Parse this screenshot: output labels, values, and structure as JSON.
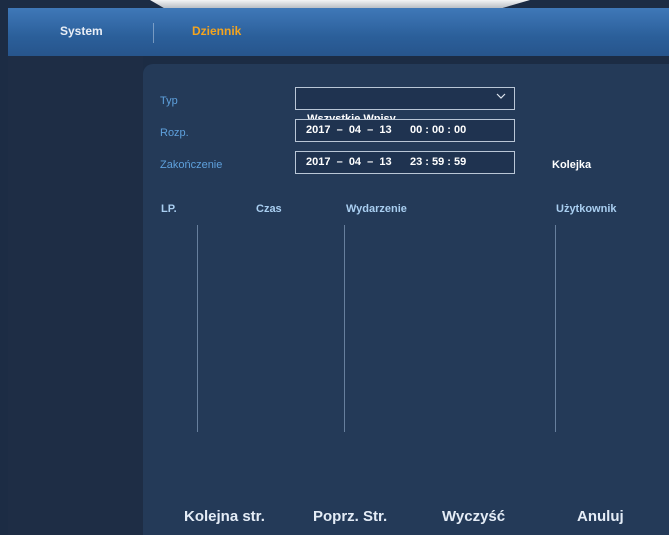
{
  "header": {
    "tabs": [
      {
        "label": "System",
        "active": false
      },
      {
        "label": "Dziennik",
        "active": true
      }
    ]
  },
  "filters": {
    "type_label": "Typ",
    "type_value": "Wszystkie Wpisy",
    "start_label": "Rozp.",
    "start_value": "2017  –  04  –  13      00 : 00 : 00",
    "end_label": "Zakończenie",
    "end_value": "2017  –  04  –  13      23 : 59 : 59",
    "queue_label": "Kolejka"
  },
  "table": {
    "columns": [
      "LP.",
      "Czas",
      "Wydarzenie",
      "Użytkownik"
    ],
    "rows": []
  },
  "footer": {
    "next_label": "Kolejna str.",
    "prev_label": "Poprz. Str.",
    "clear_label": "Wyczyść",
    "cancel_label": "Anuluj"
  },
  "colors": {
    "accent": "#f3a41f",
    "label": "#5ea0dc",
    "header_bg": "#2f66a4",
    "panel_bg": "#243a58"
  }
}
